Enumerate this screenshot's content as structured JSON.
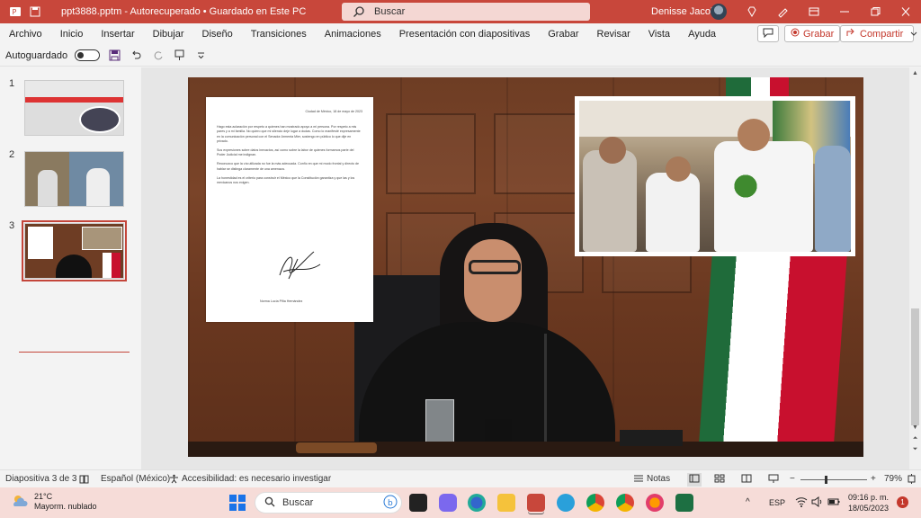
{
  "titlebar": {
    "doc_title": "ppt3888.pptm  -  Autorecuperado • Guardado en Este PC",
    "search_placeholder": "Buscar",
    "user_name": "Denisse Jacobo",
    "accent": "#c8473b"
  },
  "ribbon": {
    "tabs": [
      "Archivo",
      "Inicio",
      "Insertar",
      "Dibujar",
      "Diseño",
      "Transiciones",
      "Animaciones",
      "Presentación con diapositivas",
      "Grabar",
      "Revisar",
      "Vista",
      "Ayuda"
    ],
    "record_label": "Grabar",
    "share_label": "Compartir"
  },
  "qat": {
    "autosave_label": "Autoguardado"
  },
  "thumbnails": [
    {
      "number": "1"
    },
    {
      "number": "2"
    },
    {
      "number": "3"
    }
  ],
  "slide": {
    "letter": {
      "date": "Ciudad de México, 18 de mayo de 2023",
      "paragraphs": [
        "Hago esta aclaración por respeto a quienes han mostrado apoyo a mi persona. Por respeto a mis pares y a mi familia. No quiero que mi silencio deje lugar a dudas. Como lo manifesté expresamente en la comunicación personal con el Senador Armenta Mier, sostengo en público lo que dije en privado.",
        "Sus expresiones sobre datos inexactos, así como sobre la labor de quienes formamos parte del Poder Judicial me indignan.",
        "Reconozco que la vía utilizada no fue la más adecuada. Confío en que mi modo frontal y directo de hablar se distinga claramente de una amenaza.",
        "La honestidad es el criterio para construir el México que la Constitución garantiza y que las y los mexicanos nos exigen."
      ],
      "signature_name": "Norma Lucía Piña Hernández"
    }
  },
  "statusbar": {
    "slide_count": "Diapositiva 3 de 3",
    "language": "Español (México)",
    "accessibility": "Accesibilidad: es necesario investigar",
    "notes_label": "Notas",
    "zoom": "79%"
  },
  "taskbar": {
    "temperature": "21°C",
    "weather_desc": "Mayorm. nublado",
    "search_label": "Buscar",
    "lang": "ESP",
    "time": "09:16 p. m.",
    "date": "18/05/2023",
    "notification_count": "1"
  }
}
